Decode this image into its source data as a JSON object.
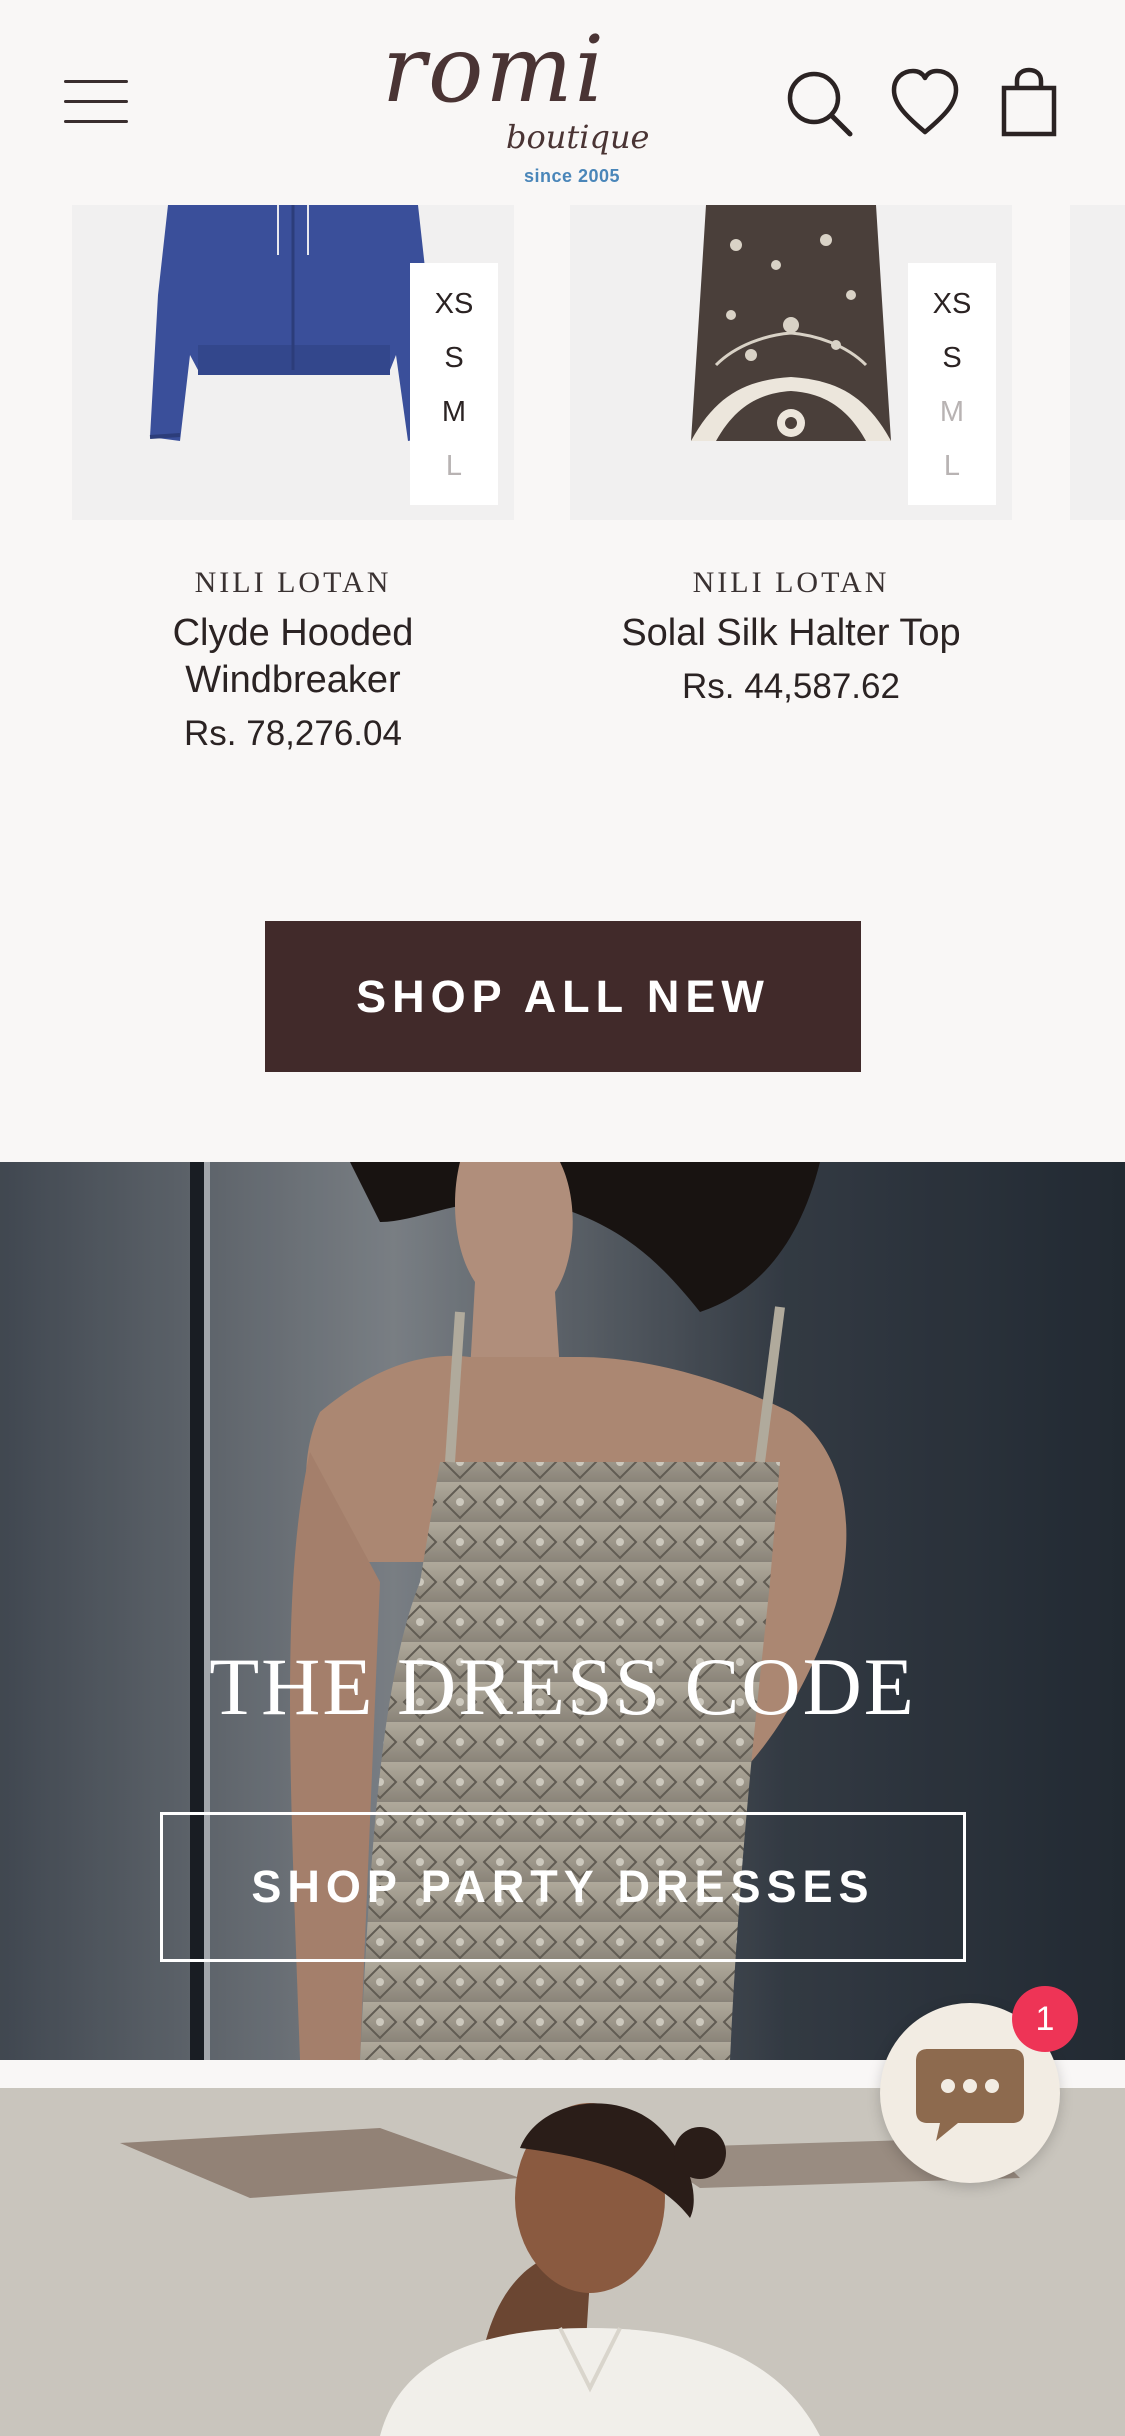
{
  "header": {
    "logo_main": "romi",
    "logo_sub": "boutique",
    "logo_since": "since 2005"
  },
  "products": [
    {
      "brand": "NILI LOTAN",
      "name": "Clyde Hooded Windbreaker",
      "price": "Rs. 78,276.04",
      "sizes": [
        {
          "label": "XS",
          "available": true
        },
        {
          "label": "S",
          "available": true
        },
        {
          "label": "M",
          "available": true
        },
        {
          "label": "L",
          "available": false
        }
      ]
    },
    {
      "brand": "NILI LOTAN",
      "name": "Solal Silk Halter Top",
      "price": "Rs. 44,587.62",
      "sizes": [
        {
          "label": "XS",
          "available": true
        },
        {
          "label": "S",
          "available": true
        },
        {
          "label": "M",
          "available": false
        },
        {
          "label": "L",
          "available": false
        }
      ]
    }
  ],
  "cta": {
    "label": "SHOP ALL NEW"
  },
  "hero": {
    "title": "THE DRESS CODE",
    "button_label": "SHOP PARTY DRESSES"
  },
  "chat": {
    "badge_count": "1"
  },
  "colors": {
    "background": "#f9f7f6",
    "cta_background": "#412a2a",
    "chat_badge": "#ee3456",
    "logo_accent": "#4a86b9"
  },
  "icons": [
    "hamburger-menu-icon",
    "search-icon",
    "heart-icon",
    "shopping-bag-icon",
    "chat-icon"
  ]
}
